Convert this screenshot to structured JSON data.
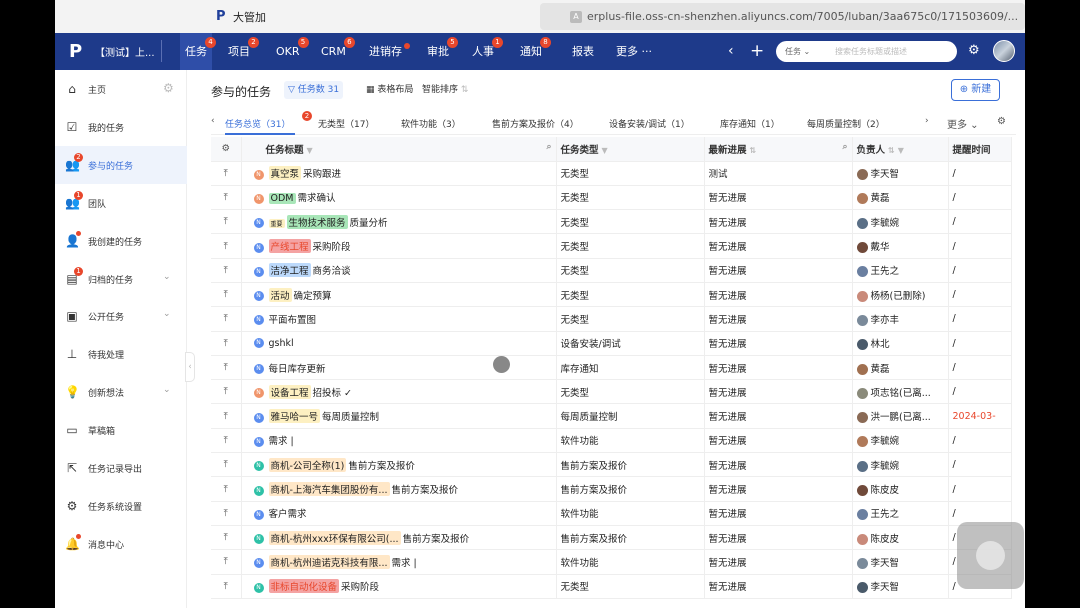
{
  "window": {
    "app_title": "大管加",
    "url": "erplus-file.oss-cn-shenzhen.aliyuncs.com/7005/luban/3aa675c0/171503609/..."
  },
  "nav": {
    "workspace": "【测试】上...",
    "items": [
      {
        "label": "任务",
        "badge": "4",
        "active": true
      },
      {
        "label": "项目",
        "badge": "2"
      },
      {
        "label": "OKR",
        "badge": "5"
      },
      {
        "label": "CRM",
        "badge": "6"
      },
      {
        "label": "进销存",
        "dot": true
      },
      {
        "label": "审批",
        "badge": "5"
      },
      {
        "label": "人事",
        "badge": "1"
      },
      {
        "label": "通知",
        "badge": "8"
      },
      {
        "label": "报表"
      },
      {
        "label": "更多 ···"
      }
    ],
    "search_prefix": "任务 ⌄",
    "search_placeholder": "搜索任务标题或描述"
  },
  "sidebar": {
    "items": [
      {
        "label": "主页",
        "icon": "home-icon"
      },
      {
        "label": "我的任务",
        "icon": "check-box-icon"
      },
      {
        "label": "参与的任务",
        "icon": "group-icon",
        "badge": "2",
        "active": true
      },
      {
        "label": "团队",
        "icon": "team-icon",
        "badge": "1"
      },
      {
        "label": "我创建的任务",
        "icon": "user-add-icon",
        "dot": true
      },
      {
        "label": "归档的任务",
        "icon": "archive-icon",
        "badge": "1",
        "chevron": true
      },
      {
        "label": "公开任务",
        "icon": "public-icon",
        "chevron": true
      },
      {
        "label": "待我处理",
        "icon": "stamp-icon"
      },
      {
        "label": "创新想法",
        "icon": "bulb-icon",
        "chevron": true
      },
      {
        "label": "草稿箱",
        "icon": "inbox-icon"
      },
      {
        "label": "任务记录导出",
        "icon": "export-icon"
      },
      {
        "label": "任务系统设置",
        "icon": "settings-icon"
      },
      {
        "label": "消息中心",
        "icon": "bell-icon",
        "dot": true
      }
    ]
  },
  "main": {
    "title": "参与的任务",
    "filter_label": "任务数 31",
    "layout_label": "表格布局",
    "sort_label": "智能排序",
    "new_label": "新建",
    "tabs": [
      {
        "label": "任务总览（31）",
        "active": true,
        "badge": "2"
      },
      {
        "label": "无类型（17）"
      },
      {
        "label": "软件功能（3）"
      },
      {
        "label": "售前方案及报价（4）"
      },
      {
        "label": "设备安装/调试（1）"
      },
      {
        "label": "库存通知（1）"
      },
      {
        "label": "每周质量控制（2）"
      }
    ],
    "tabs_more": "更多",
    "columns": [
      "任务标题",
      "任务类型",
      "最新进展",
      "负责人",
      "提醒时间"
    ],
    "rows": [
      {
        "prefix_tag": "",
        "tag": "真空泵",
        "tag_color": "yellow",
        "title": "采购跟进",
        "type": "无类型",
        "progress": "测试",
        "owner": "李天智",
        "remind": "/",
        "icon": "or"
      },
      {
        "prefix_tag": "",
        "tag": "ODM",
        "tag_color": "green",
        "title": "需求确认",
        "type": "无类型",
        "progress": "暂无进展",
        "owner": "黄磊",
        "remind": "/",
        "icon": "or"
      },
      {
        "prefix_tag": "重要",
        "tag": "生物技术服务",
        "tag_color": "green",
        "title": "质量分析",
        "type": "无类型",
        "progress": "暂无进展",
        "owner": "李毓婉",
        "remind": "/",
        "icon": "bl"
      },
      {
        "prefix_tag": "",
        "tag": "产线工程",
        "tag_color": "red",
        "title": "采购阶段",
        "type": "无类型",
        "progress": "暂无进展",
        "owner": "戴华",
        "remind": "/",
        "icon": "bl"
      },
      {
        "prefix_tag": "",
        "tag": "洁净工程",
        "tag_color": "blue",
        "title": "商务洽谈",
        "type": "无类型",
        "progress": "暂无进展",
        "owner": "王先之",
        "remind": "/",
        "icon": "bl"
      },
      {
        "prefix_tag": "",
        "tag": "活动",
        "tag_color": "yellow",
        "title": "确定预算",
        "type": "无类型",
        "progress": "暂无进展",
        "owner": "杨杨(已删除)",
        "remind": "/",
        "icon": "bl"
      },
      {
        "prefix_tag": "",
        "tag": "",
        "tag_color": "",
        "title": "平面布置图",
        "type": "无类型",
        "progress": "暂无进展",
        "owner": "李亦丰",
        "remind": "/",
        "icon": "bl"
      },
      {
        "prefix_tag": "",
        "tag": "",
        "tag_color": "",
        "title": "gshkl",
        "type": "设备安装/调试",
        "progress": "暂无进展",
        "owner": "林北",
        "remind": "/",
        "icon": "bl"
      },
      {
        "prefix_tag": "",
        "tag": "",
        "tag_color": "",
        "title": "每日库存更新",
        "type": "库存通知",
        "progress": "暂无进展",
        "owner": "黄磊",
        "remind": "/",
        "icon": "bl"
      },
      {
        "prefix_tag": "",
        "tag": "设备工程",
        "tag_color": "yellow",
        "title": "招投标 ✓",
        "type": "无类型",
        "progress": "暂无进展",
        "owner": "项志铭(已离...",
        "remind": "/",
        "icon": "or"
      },
      {
        "prefix_tag": "",
        "tag": "雅马哈一号",
        "tag_color": "yellow",
        "title": "每周质量控制",
        "type": "每周质量控制",
        "progress": "暂无进展",
        "owner": "洪一鹏(已离...",
        "remind": "2024-03-",
        "remind_red": true,
        "icon": "bl"
      },
      {
        "prefix_tag": "",
        "tag": "",
        "tag_color": "",
        "title": "需求 |",
        "type": "软件功能",
        "progress": "暂无进展",
        "owner": "李毓婉",
        "remind": "/",
        "icon": "bl"
      },
      {
        "prefix_tag": "",
        "tag": "商机-公司全称(1)",
        "tag_color": "peach",
        "title": "售前方案及报价",
        "type": "售前方案及报价",
        "progress": "暂无进展",
        "owner": "李毓婉",
        "remind": "/",
        "icon": "gr"
      },
      {
        "prefix_tag": "",
        "tag": "商机-上海汽车集团股份有...",
        "tag_color": "peach",
        "title": "售前方案及报价",
        "type": "售前方案及报价",
        "progress": "暂无进展",
        "owner": "陈皮皮",
        "remind": "/",
        "icon": "gr"
      },
      {
        "prefix_tag": "",
        "tag": "",
        "tag_color": "",
        "title": "客户需求",
        "type": "软件功能",
        "progress": "暂无进展",
        "owner": "王先之",
        "remind": "/",
        "icon": "bl"
      },
      {
        "prefix_tag": "",
        "tag": "商机-杭州xxx环保有限公司(...",
        "tag_color": "peach",
        "title": "售前方案及报价",
        "type": "售前方案及报价",
        "progress": "暂无进展",
        "owner": "陈皮皮",
        "remind": "/",
        "icon": "gr"
      },
      {
        "prefix_tag": "",
        "tag": "商机-杭州迪诺克科技有限...",
        "tag_color": "peach",
        "title": "需求 |",
        "type": "软件功能",
        "progress": "暂无进展",
        "owner": "李天智",
        "remind": "/",
        "icon": "bl"
      },
      {
        "prefix_tag": "",
        "tag": "非标自动化设备",
        "tag_color": "red",
        "title": "采购阶段",
        "type": "无类型",
        "progress": "暂无进展",
        "owner": "李天智",
        "remind": "/",
        "icon": "gr"
      }
    ]
  }
}
